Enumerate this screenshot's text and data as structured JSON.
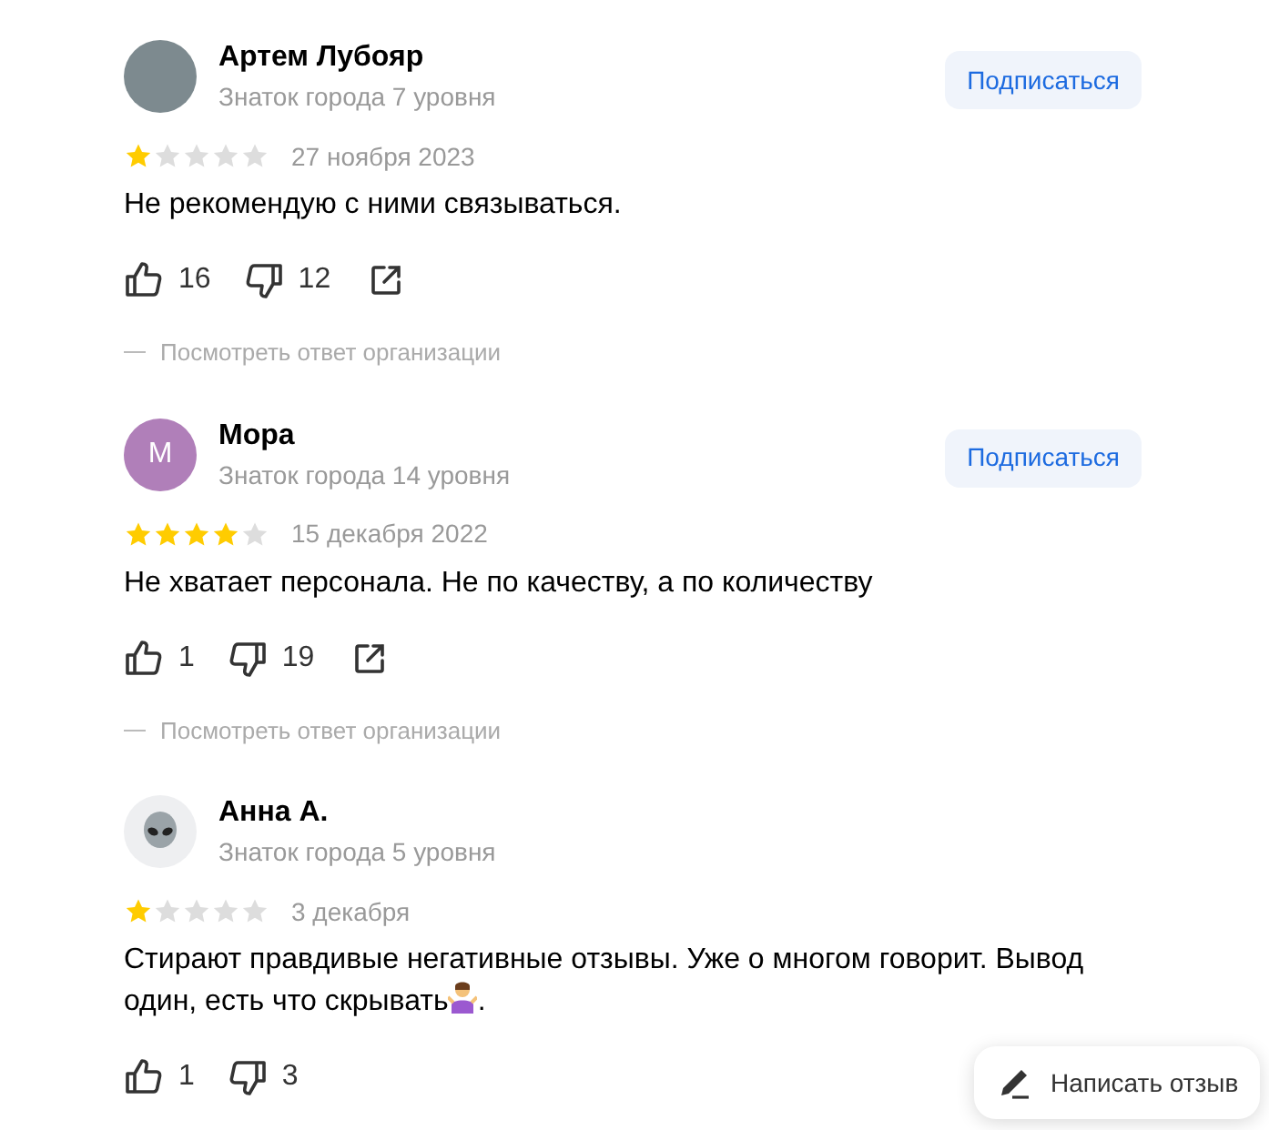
{
  "reviews": [
    {
      "avatar": {
        "kind": "photo"
      },
      "name": "Артем Лубояр",
      "level": "Знаток города 7 уровня",
      "subscribe": "Подписаться",
      "stars": 1,
      "date": "27 ноября 2023",
      "text": "Не рекомендую с ними связываться.",
      "likes": "16",
      "dislikes": "12",
      "share": true,
      "reply_link": "Посмотреть ответ организации"
    },
    {
      "avatar": {
        "kind": "letter",
        "letter": "М",
        "color": "#b07fb9"
      },
      "name": "Мора",
      "level": "Знаток города 14 уровня",
      "subscribe": "Подписаться",
      "stars": 4,
      "date": "15 декабря 2022",
      "text": "Не хватает персонала. Не по качеству, а по количеству",
      "likes": "1",
      "dislikes": "19",
      "share": true,
      "reply_link": "Посмотреть ответ организации"
    },
    {
      "avatar": {
        "kind": "alien"
      },
      "name": "Анна А.",
      "level": "Знаток города 5 уровня",
      "stars": 1,
      "date": "3 декабря",
      "text": "Стирают правдивые негативные отзывы. Уже о многом говорит. Вывод один, есть что скрывать",
      "emoji": {
        "kind": "shrug"
      },
      "text_end": ".",
      "likes": "1",
      "dislikes": "3",
      "share": false
    }
  ],
  "write_review": "Написать отзыв"
}
